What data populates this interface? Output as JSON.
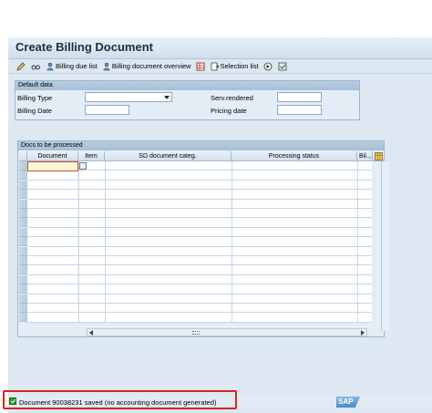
{
  "window": {
    "title": "Create Billing Document"
  },
  "toolbar": {
    "items": [
      {
        "label": "",
        "icon": "pencil-icon"
      },
      {
        "label": "",
        "icon": "glasses-icon"
      },
      {
        "label": "Billing due list",
        "icon": "person-list-icon"
      },
      {
        "label": "Billing document overview",
        "icon": "person-list-icon"
      },
      {
        "label": "",
        "icon": "table-icon"
      },
      {
        "label": "Selection list",
        "icon": "selection-list-icon"
      },
      {
        "label": "",
        "icon": "execute-icon"
      },
      {
        "label": "",
        "icon": "save-icon"
      }
    ]
  },
  "default_data": {
    "header": "Default data",
    "billing_type_label": "Billing Type",
    "billing_type_value": "",
    "billing_date_label": "Billing Date",
    "billing_date_value": "",
    "serv_rendered_label": "Serv.rendered",
    "serv_rendered_value": "",
    "pricing_date_label": "Pricing date",
    "pricing_date_value": ""
  },
  "docs_table": {
    "header": "Docs to be processed",
    "columns": [
      "Document",
      "Item",
      "SD document categ.",
      "Processing status",
      "Bil..."
    ],
    "row_count": 17
  },
  "status": {
    "message": "Document 90038231 saved (no accounting document generated)",
    "type": "success"
  },
  "brand": {
    "logo_text": "SAP"
  },
  "colors": {
    "background": "#dde8f2",
    "status_highlight": "#d9231e",
    "success": "#2e9a2a"
  }
}
